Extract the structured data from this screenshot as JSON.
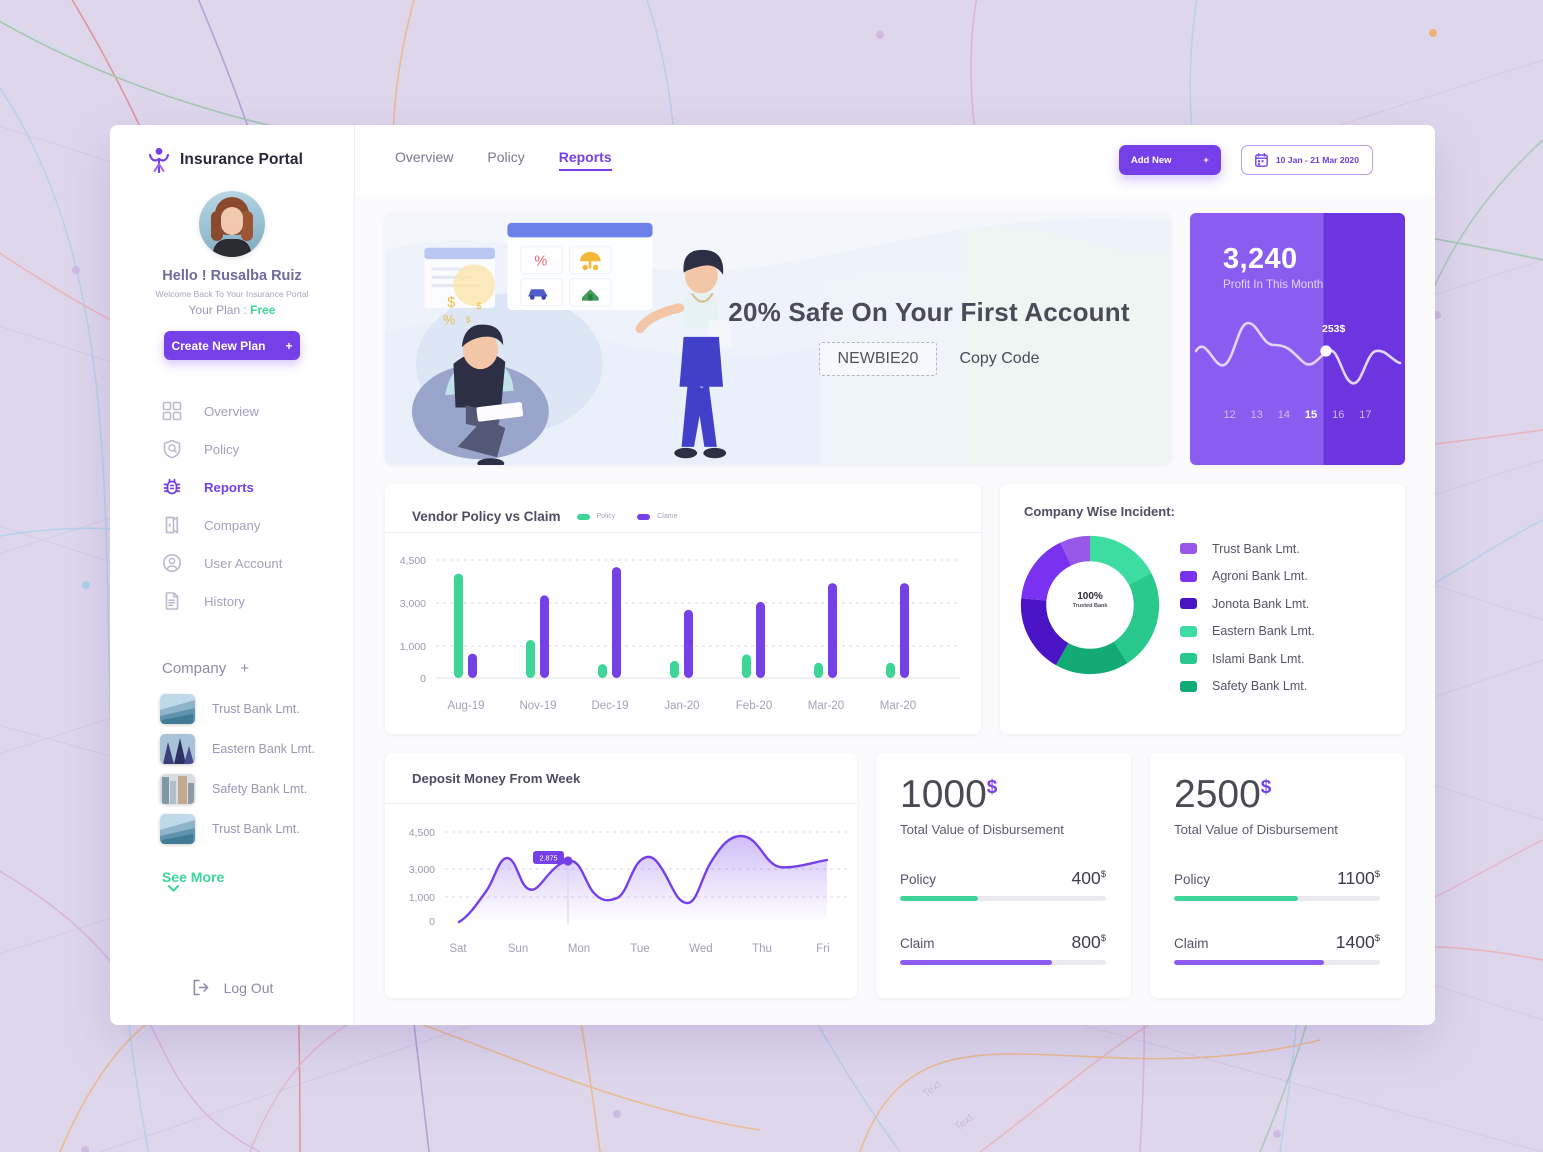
{
  "brand": {
    "name": "Insurance Portal",
    "logo_icon": "person-logo-icon"
  },
  "profile": {
    "greeting": "Hello ! Rusalba Ruiz",
    "welcome": "Welcome Back To Your Insurance Portal",
    "plan_label": "Your Plan :",
    "plan_value": "Free",
    "cta_label": "Create New Plan",
    "cta_plus": "+"
  },
  "sidebar": {
    "items": [
      {
        "label": "Overview",
        "icon": "grid-icon",
        "active": false
      },
      {
        "label": "Policy",
        "icon": "shield-icon",
        "active": false
      },
      {
        "label": "Reports",
        "icon": "bug-icon",
        "active": true
      },
      {
        "label": "Company",
        "icon": "building-icon",
        "active": false
      },
      {
        "label": "User Account",
        "icon": "user-icon",
        "active": false
      },
      {
        "label": "History",
        "icon": "document-icon",
        "active": false
      }
    ],
    "company_section": {
      "title": "Company",
      "add": "+"
    },
    "companies": [
      {
        "name": "Trust Bank Lmt."
      },
      {
        "name": "Eastern Bank Lmt."
      },
      {
        "name": "Safety Bank Lmt."
      },
      {
        "name": "Trust Bank Lmt."
      }
    ],
    "see_more": "See More",
    "logout": "Log Out"
  },
  "topbar": {
    "tabs": [
      {
        "label": "Overview",
        "active": false
      },
      {
        "label": "Policy",
        "active": false
      },
      {
        "label": "Reports",
        "active": true
      }
    ],
    "add_new": "Add New",
    "add_new_plus": "+",
    "date_range": "10 Jan - 21 Mar 2020",
    "calendar_icon": "calendar-icon"
  },
  "banner": {
    "headline": "20% Safe On Your First Account",
    "code": "NEWBIE20",
    "copy_label": "Copy Code"
  },
  "profit_card": {
    "value": "3,240",
    "label": "Profit In This Month",
    "tooltip": "253$",
    "days": [
      "12",
      "13",
      "14",
      "15",
      "16",
      "17"
    ],
    "highlight_day": "15"
  },
  "colors": {
    "purple": "#7540e8",
    "purple_light": "#8b5cf0",
    "purple_dark": "#6d35e0",
    "green": "#3dd598",
    "page_bg": "#ded7ec"
  },
  "chart_data": [
    {
      "type": "bar",
      "title": "Vendor Policy vs Claim",
      "categories": [
        "Aug-19",
        "Nov-19",
        "Dec-19",
        "Jan-20",
        "Feb-20",
        "Mar-20",
        "Mar-20"
      ],
      "series": [
        {
          "name": "Policy",
          "color": "#3dd598",
          "values": [
            3980,
            1450,
            530,
            650,
            900,
            580,
            580
          ]
        },
        {
          "name": "Clame",
          "color": "#7540e8",
          "values": [
            930,
            3150,
            4230,
            2600,
            2900,
            3620,
            3620
          ]
        }
      ],
      "ylim": [
        0,
        4500
      ],
      "yticks": [
        "4,500",
        "3,000",
        "1,000",
        "0"
      ],
      "ytick_values": [
        4500,
        3000,
        1000,
        0
      ],
      "grid": true,
      "legend_position": "top"
    },
    {
      "type": "pie",
      "title": "Company Wise Incident:",
      "center_label": "100%",
      "center_sublabel": "Trusted Bank",
      "labels": [
        "Trust Bank Lmt.",
        "Agroni Bank Lmt.",
        "Jonota Bank Lmt.",
        "Eastern Bank Lmt.",
        "Islami Bank Lmt.",
        "Safety Bank Lmt."
      ],
      "colors": [
        "#9757e8",
        "#7b31f0",
        "#4a13c4",
        "#3ddca0",
        "#29c88c",
        "#12ab73"
      ],
      "values": [
        9,
        16,
        18,
        17,
        23,
        17
      ],
      "legend_position": "right"
    },
    {
      "type": "area",
      "title": "Deposit Money From Week",
      "categories": [
        "Sat",
        "Sun",
        "Mon",
        "Tue",
        "Wed",
        "Thu",
        "Fri"
      ],
      "values": [
        280,
        3380,
        3250,
        3950,
        4400,
        3500,
        3650
      ],
      "ylim": [
        0,
        4500
      ],
      "yticks": [
        "4,500",
        "3,000",
        "1,000",
        "0"
      ],
      "ytick_values": [
        4500,
        3000,
        1000,
        0
      ],
      "tooltip": "2.875",
      "line_color": "#7540e8",
      "grid": true
    }
  ],
  "stat_cards": [
    {
      "value": "1000",
      "currency": "$",
      "subtitle": "Total Value of Disbursement",
      "bars": [
        {
          "name": "Policy",
          "value": "400",
          "currency": "$",
          "percent": 38,
          "color": "#3dd598"
        },
        {
          "name": "Claim",
          "value": "800",
          "currency": "$",
          "percent": 74,
          "color": "#8b5cf0"
        }
      ]
    },
    {
      "value": "2500",
      "currency": "$",
      "subtitle": "Total Value of Disbursement",
      "bars": [
        {
          "name": "Policy",
          "value": "1100",
          "currency": "$",
          "percent": 60,
          "color": "#3dd598"
        },
        {
          "name": "Claim",
          "value": "1400",
          "currency": "$",
          "percent": 73,
          "color": "#8b5cf0"
        }
      ]
    }
  ]
}
